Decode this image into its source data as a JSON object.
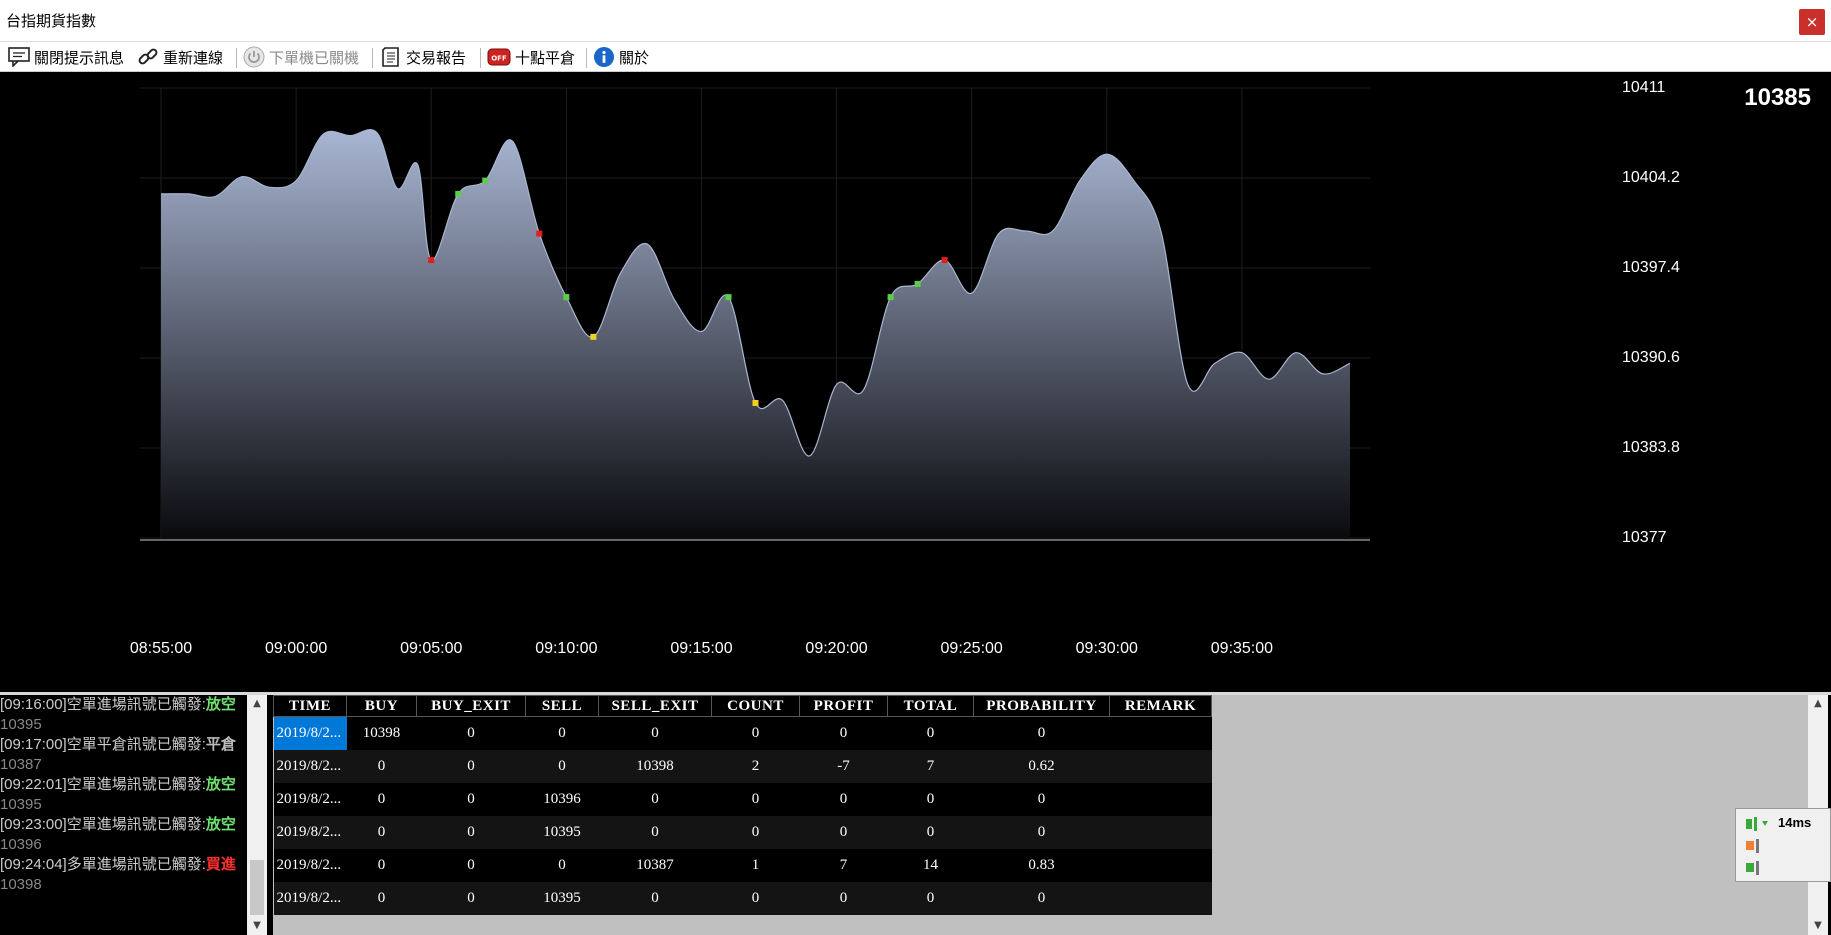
{
  "window": {
    "title": "台指期貨指數",
    "close_label": "×"
  },
  "toolbar": {
    "items": [
      {
        "label": "關閉提示訊息",
        "icon": "speech-bubble-icon"
      },
      {
        "label": "重新連線",
        "icon": "chain-link-icon"
      },
      {
        "label": "下單機已關機",
        "icon": "power-icon"
      },
      {
        "label": "交易報告",
        "icon": "report-icon"
      },
      {
        "label": "十點平倉",
        "icon": "off-switch-icon"
      },
      {
        "label": "關於",
        "icon": "info-icon"
      }
    ]
  },
  "current_price": "10385",
  "chart_data": {
    "type": "area",
    "x_ticks": [
      "08:55:00",
      "09:00:00",
      "09:05:00",
      "09:10:00",
      "09:15:00",
      "09:20:00",
      "09:25:00",
      "09:30:00",
      "09:35:00"
    ],
    "y_ticks": [
      "10411",
      "10404.2",
      "10397.4",
      "10390.6",
      "10383.8",
      "10377"
    ],
    "ylim": [
      10377,
      10411
    ],
    "xlim": [
      "08:55:00",
      "09:39:00"
    ],
    "grid": true,
    "series": [
      {
        "points": [
          [
            "08:55:00",
            10403.0
          ],
          [
            "08:56:00",
            10403.0
          ],
          [
            "08:57:00",
            10402.8
          ],
          [
            "08:58:00",
            10404.3
          ],
          [
            "08:59:00",
            10403.5
          ],
          [
            "09:00:00",
            10404.0
          ],
          [
            "09:01:00",
            10407.5
          ],
          [
            "09:02:00",
            10407.4
          ],
          [
            "09:03:00",
            10407.6
          ],
          [
            "09:03:45",
            10403.4
          ],
          [
            "09:04:30",
            10405.2
          ],
          [
            "09:05:00",
            10398.0
          ],
          [
            "09:06:00",
            10403.0
          ],
          [
            "09:07:00",
            10404.0
          ],
          [
            "09:08:00",
            10407.0
          ],
          [
            "09:09:00",
            10400.0
          ],
          [
            "09:10:00",
            10395.2
          ],
          [
            "09:11:00",
            10392.2
          ],
          [
            "09:12:00",
            10397.0
          ],
          [
            "09:13:00",
            10399.2
          ],
          [
            "09:14:00",
            10395.0
          ],
          [
            "09:15:00",
            10392.6
          ],
          [
            "09:16:00",
            10395.2
          ],
          [
            "09:17:00",
            10387.2
          ],
          [
            "09:18:00",
            10387.4
          ],
          [
            "09:19:00",
            10383.2
          ],
          [
            "09:20:00",
            10388.6
          ],
          [
            "09:21:00",
            10388.2
          ],
          [
            "09:22:00",
            10395.2
          ],
          [
            "09:23:00",
            10396.2
          ],
          [
            "09:24:00",
            10398.0
          ],
          [
            "09:25:00",
            10395.5
          ],
          [
            "09:26:00",
            10400.0
          ],
          [
            "09:27:00",
            10400.2
          ],
          [
            "09:28:00",
            10400.2
          ],
          [
            "09:29:00",
            10404.0
          ],
          [
            "09:30:00",
            10406.0
          ],
          [
            "09:31:00",
            10404.0
          ],
          [
            "09:32:00",
            10400.2
          ],
          [
            "09:33:00",
            10388.6
          ],
          [
            "09:34:00",
            10390.2
          ],
          [
            "09:35:00",
            10391.0
          ],
          [
            "09:36:00",
            10389.0
          ],
          [
            "09:37:00",
            10391.0
          ],
          [
            "09:38:00",
            10389.4
          ],
          [
            "09:39:00",
            10390.2
          ]
        ]
      }
    ],
    "markers": [
      {
        "x": "09:05:00",
        "y": 10398.0,
        "color": "#e02020"
      },
      {
        "x": "09:06:00",
        "y": 10403.0,
        "color": "#5ad04a"
      },
      {
        "x": "09:07:00",
        "y": 10404.0,
        "color": "#5ad04a"
      },
      {
        "x": "09:09:00",
        "y": 10400.0,
        "color": "#e02020"
      },
      {
        "x": "09:10:00",
        "y": 10395.2,
        "color": "#5ad04a"
      },
      {
        "x": "09:11:00",
        "y": 10392.2,
        "color": "#f0d020"
      },
      {
        "x": "09:16:00",
        "y": 10395.2,
        "color": "#5ad04a"
      },
      {
        "x": "09:17:00",
        "y": 10387.2,
        "color": "#f0d020"
      },
      {
        "x": "09:22:00",
        "y": 10395.2,
        "color": "#5ad04a"
      },
      {
        "x": "09:23:00",
        "y": 10396.2,
        "color": "#5ad04a"
      },
      {
        "x": "09:24:00",
        "y": 10398.0,
        "color": "#e02020"
      }
    ],
    "colors": {
      "fill_top": "#a9b6d3",
      "fill_bottom": "#0a0a0e",
      "grid": "#1e1e1e",
      "axis": "#cccccc"
    }
  },
  "log": {
    "entries": [
      {
        "time": "[09:16:00]",
        "text": "空單進場訊號已觸發:",
        "action": "放空",
        "action_color": "#6fe06f",
        "price": "10395"
      },
      {
        "time": "[09:17:00]",
        "text": "空單平倉訊號已觸發:",
        "action": "平倉",
        "action_color": "#bbbbbb",
        "price": "10387"
      },
      {
        "time": "[09:22:01]",
        "text": "空單進場訊號已觸發:",
        "action": "放空",
        "action_color": "#6fe06f",
        "price": "10395"
      },
      {
        "time": "[09:23:00]",
        "text": "空單進場訊號已觸發:",
        "action": "放空",
        "action_color": "#6fe06f",
        "price": "10396"
      },
      {
        "time": "[09:24:04]",
        "text": "多單進場訊號已觸發:",
        "action": "買進",
        "action_color": "#ff3030",
        "price": "10398"
      }
    ]
  },
  "table": {
    "columns": [
      "TIME",
      "BUY",
      "BUY_EXIT",
      "SELL",
      "SELL_EXIT",
      "COUNT",
      "PROFIT",
      "TOTAL",
      "PROBABILITY",
      "REMARK"
    ],
    "rows": [
      [
        "2019/8/2...",
        "10398",
        "0",
        "0",
        "0",
        "0",
        "0",
        "0",
        "0",
        ""
      ],
      [
        "2019/8/2...",
        "0",
        "0",
        "0",
        "10398",
        "2",
        "-7",
        "7",
        "0.62",
        ""
      ],
      [
        "2019/8/2...",
        "0",
        "0",
        "10396",
        "0",
        "0",
        "0",
        "0",
        "0",
        ""
      ],
      [
        "2019/8/2...",
        "0",
        "0",
        "10395",
        "0",
        "0",
        "0",
        "0",
        "0",
        ""
      ],
      [
        "2019/8/2...",
        "0",
        "0",
        "0",
        "10387",
        "1",
        "7",
        "14",
        "0.83",
        ""
      ],
      [
        "2019/8/2...",
        "0",
        "0",
        "10395",
        "0",
        "0",
        "0",
        "0",
        "0",
        ""
      ]
    ]
  },
  "status": {
    "latency": "14ms"
  }
}
